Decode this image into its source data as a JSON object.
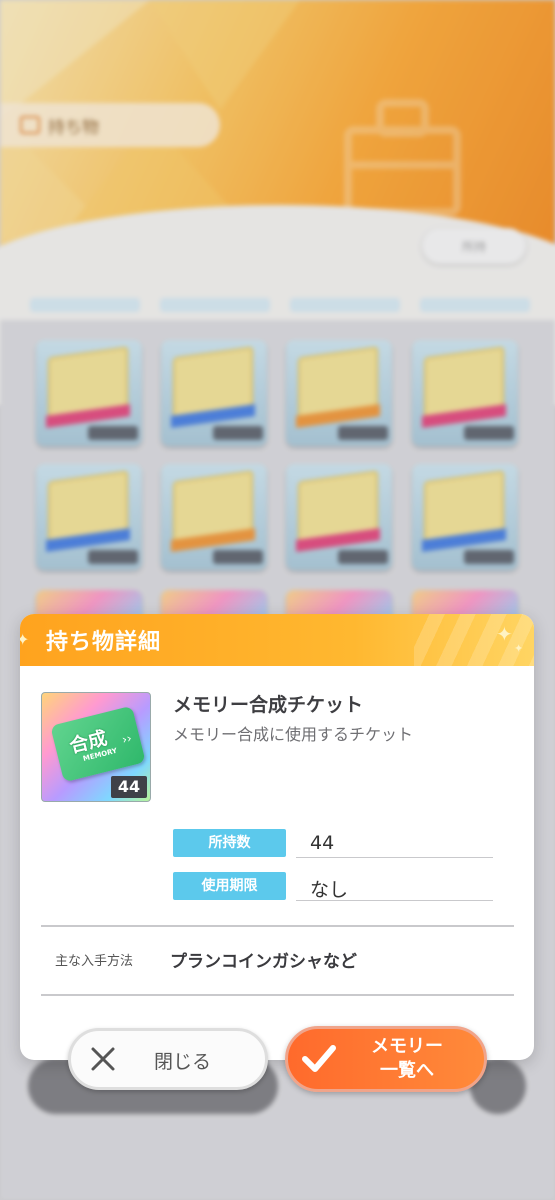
{
  "background": {
    "section_title": "持ち物",
    "sort_label": "所持",
    "grid_items": [
      {
        "stripe": "#e0306e"
      },
      {
        "stripe": "#2f6fe0"
      },
      {
        "stripe": "#f08a1e"
      },
      {
        "stripe": "#e0306e"
      },
      {
        "stripe": "#2f6fe0"
      },
      {
        "stripe": "#f08a1e"
      },
      {
        "stripe": "#e0306e"
      },
      {
        "stripe": "#2f6fe0"
      }
    ]
  },
  "dialog": {
    "title": "持ち物詳細",
    "item": {
      "name": "メモリー合成チケット",
      "description": "メモリー合成に使用するチケット",
      "icon": "memory-synthesis-ticket",
      "icon_text": "合成",
      "icon_subtext": "MEMORY",
      "count_badge": "44"
    },
    "fields": [
      {
        "label": "所持数",
        "value": "44"
      },
      {
        "label": "使用期限",
        "value": "なし"
      }
    ],
    "source": {
      "label": "主な入手方法",
      "value": "プランコインガシャなど"
    }
  },
  "buttons": {
    "close": {
      "label": "閉じる",
      "icon": "close-icon"
    },
    "memory_list": {
      "label": "メモリー\n一覧へ",
      "icon": "check-icon"
    }
  },
  "colors": {
    "header_orange": "#ffa31e",
    "label_blue": "#5cc9ec",
    "primary_button": "#ff6a2c"
  }
}
